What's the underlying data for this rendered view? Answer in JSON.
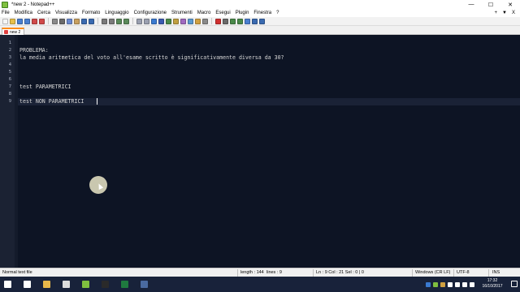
{
  "window": {
    "title": "*new 2 - Notepad++",
    "minimize": "—",
    "maximize": "☐",
    "close": "✕"
  },
  "menu": {
    "items": [
      "File",
      "Modifica",
      "Cerca",
      "Visualizza",
      "Formato",
      "Linguaggio",
      "Configurazione",
      "Strumenti",
      "Macro",
      "Esegui",
      "Plugin",
      "Finestra",
      "?"
    ],
    "right": [
      "+",
      "▼",
      "X"
    ]
  },
  "toolbar": {
    "icons": [
      {
        "name": "new-file-icon",
        "color": "#f5f5f5"
      },
      {
        "name": "open-folder-icon",
        "color": "#e8c04a"
      },
      {
        "name": "save-icon",
        "color": "#4a7fd0"
      },
      {
        "name": "save-all-icon",
        "color": "#4a7fd0"
      },
      {
        "name": "close-icon",
        "color": "#d04a4a"
      },
      {
        "name": "close-all-icon",
        "color": "#d04a4a"
      },
      {
        "name": "print-icon",
        "color": "#8a8a8a"
      },
      {
        "name": "cut-icon",
        "color": "#6a6a6a"
      },
      {
        "name": "copy-icon",
        "color": "#6a8ad0"
      },
      {
        "name": "paste-icon",
        "color": "#c8a060"
      },
      {
        "name": "undo-icon",
        "color": "#3a6ab0"
      },
      {
        "name": "redo-icon",
        "color": "#3a6ab0"
      },
      {
        "name": "find-icon",
        "color": "#7a7a7a"
      },
      {
        "name": "replace-icon",
        "color": "#7a7a7a"
      },
      {
        "name": "zoom-in-icon",
        "color": "#5a8a5a"
      },
      {
        "name": "zoom-out-icon",
        "color": "#5a8a5a"
      },
      {
        "name": "sync-v-icon",
        "color": "#9aa0b0"
      },
      {
        "name": "sync-h-icon",
        "color": "#9aa0b0"
      },
      {
        "name": "word-wrap-icon",
        "color": "#3a7ad0"
      },
      {
        "name": "all-chars-icon",
        "color": "#3a5ab0"
      },
      {
        "name": "indent-guide-icon",
        "color": "#4a8a4a"
      },
      {
        "name": "udl-icon",
        "color": "#c0a040"
      },
      {
        "name": "doc-map-icon",
        "color": "#a06ac0"
      },
      {
        "name": "function-list-icon",
        "color": "#5a9ad0"
      },
      {
        "name": "folder-workspace-icon",
        "color": "#d0a040"
      },
      {
        "name": "monitoring-icon",
        "color": "#8a8a8a"
      },
      {
        "name": "record-macro-icon",
        "color": "#d03030"
      },
      {
        "name": "stop-macro-icon",
        "color": "#6a6a6a"
      },
      {
        "name": "play-macro-icon",
        "color": "#4a8a4a"
      },
      {
        "name": "play-multi-icon",
        "color": "#4a8a4a"
      },
      {
        "name": "save-macro-icon",
        "color": "#4a7fd0"
      },
      {
        "name": "spell-check-icon",
        "color": "#3a6ab0"
      },
      {
        "name": "abc-icon",
        "color": "#3a6ab0"
      }
    ]
  },
  "tabs": [
    {
      "label": "new 2",
      "active": true
    }
  ],
  "editor": {
    "lines": [
      {
        "n": "1",
        "text": ""
      },
      {
        "n": "2",
        "text": "PROBLEMA:"
      },
      {
        "n": "3",
        "text": "la media aritmetica del voto all'esame scritto è significativamente diversa da 30?"
      },
      {
        "n": "4",
        "text": ""
      },
      {
        "n": "5",
        "text": ""
      },
      {
        "n": "6",
        "text": ""
      },
      {
        "n": "7",
        "text": "test PARAMETRICI"
      },
      {
        "n": "8",
        "text": ""
      },
      {
        "n": "9",
        "text": "test NON PARAMETRICI"
      }
    ],
    "current_line": 9
  },
  "status": {
    "type": "Normal text file",
    "length": "length : 144",
    "lines": "lines : 9",
    "position": "Ln : 9    Col : 21    Sel : 0 | 0",
    "eol": "Windows (CR LF)",
    "encoding": "UTF-8",
    "mode": "INS"
  },
  "taskbar": {
    "apps": [
      {
        "name": "start-button",
        "color": "#ffffff"
      },
      {
        "name": "task-view-icon",
        "color": "#ffffff"
      },
      {
        "name": "explorer-icon",
        "color": "#e8b84a"
      },
      {
        "name": "calculator-icon",
        "color": "#dcdcdc"
      },
      {
        "name": "notepad-plus-icon",
        "color": "#7fbf3f"
      },
      {
        "name": "sticky-notes-icon",
        "color": "#2a2a2a"
      },
      {
        "name": "excel-icon",
        "color": "#1f7a3f"
      },
      {
        "name": "app-icon",
        "color": "#4a6aa0"
      }
    ],
    "time": "17:32",
    "date": "16/10/2017"
  }
}
